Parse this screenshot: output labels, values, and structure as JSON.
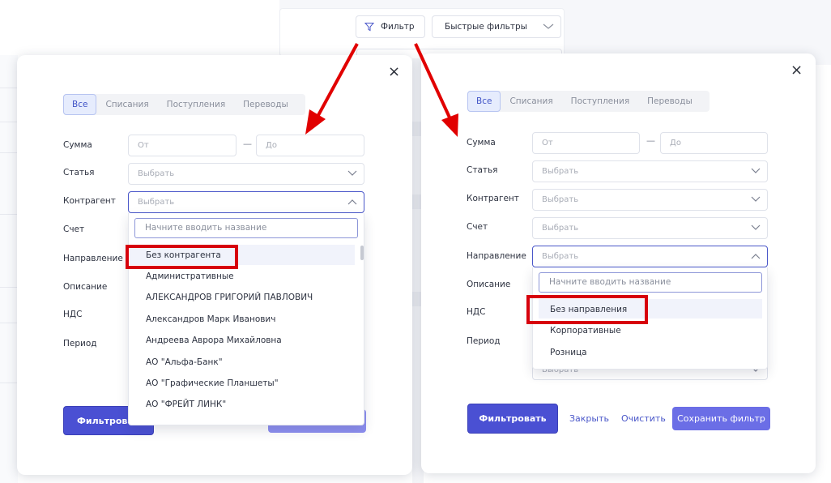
{
  "top": {
    "filter_label": "Фильтр",
    "quick_filters_label": "Быстрые фильтры"
  },
  "tabs": [
    "Все",
    "Списания",
    "Поступления",
    "Переводы"
  ],
  "labels": {
    "sum": "Сумма",
    "article": "Статья",
    "counterparty": "Контрагент",
    "account": "Счет",
    "direction": "Направление",
    "description": "Описание",
    "vat": "НДС",
    "period": "Период"
  },
  "placeholders": {
    "from": "От",
    "to": "До",
    "select": "Выбрать",
    "search_name": "Начните вводить название"
  },
  "dash": "—",
  "left_dropdown_items": [
    "Без контрагента",
    "Административные",
    "АЛЕКСАНДРОВ ГРИГОРИЙ ПАВЛОВИЧ",
    "Александров Марк Иванович",
    "Андреева Аврора Михайловна",
    "АО \"Альфа-Банк\"",
    "АО \"Графические Планшеты\"",
    "АО \"ФРЕЙТ ЛИНК\""
  ],
  "right_dropdown_items": [
    "Без направления",
    "Корпоративные",
    "Розница"
  ],
  "buttons": {
    "filter": "Фильтровать",
    "filter_partial": "Фильтрова",
    "close": "Закрыть",
    "clear": "Очистить",
    "save_filter": "Сохранить фильтр",
    "close_icon": "×"
  },
  "colors": {
    "accent": "#4a50d3",
    "highlight_box": "#d7000c",
    "arrow": "#e10000"
  }
}
